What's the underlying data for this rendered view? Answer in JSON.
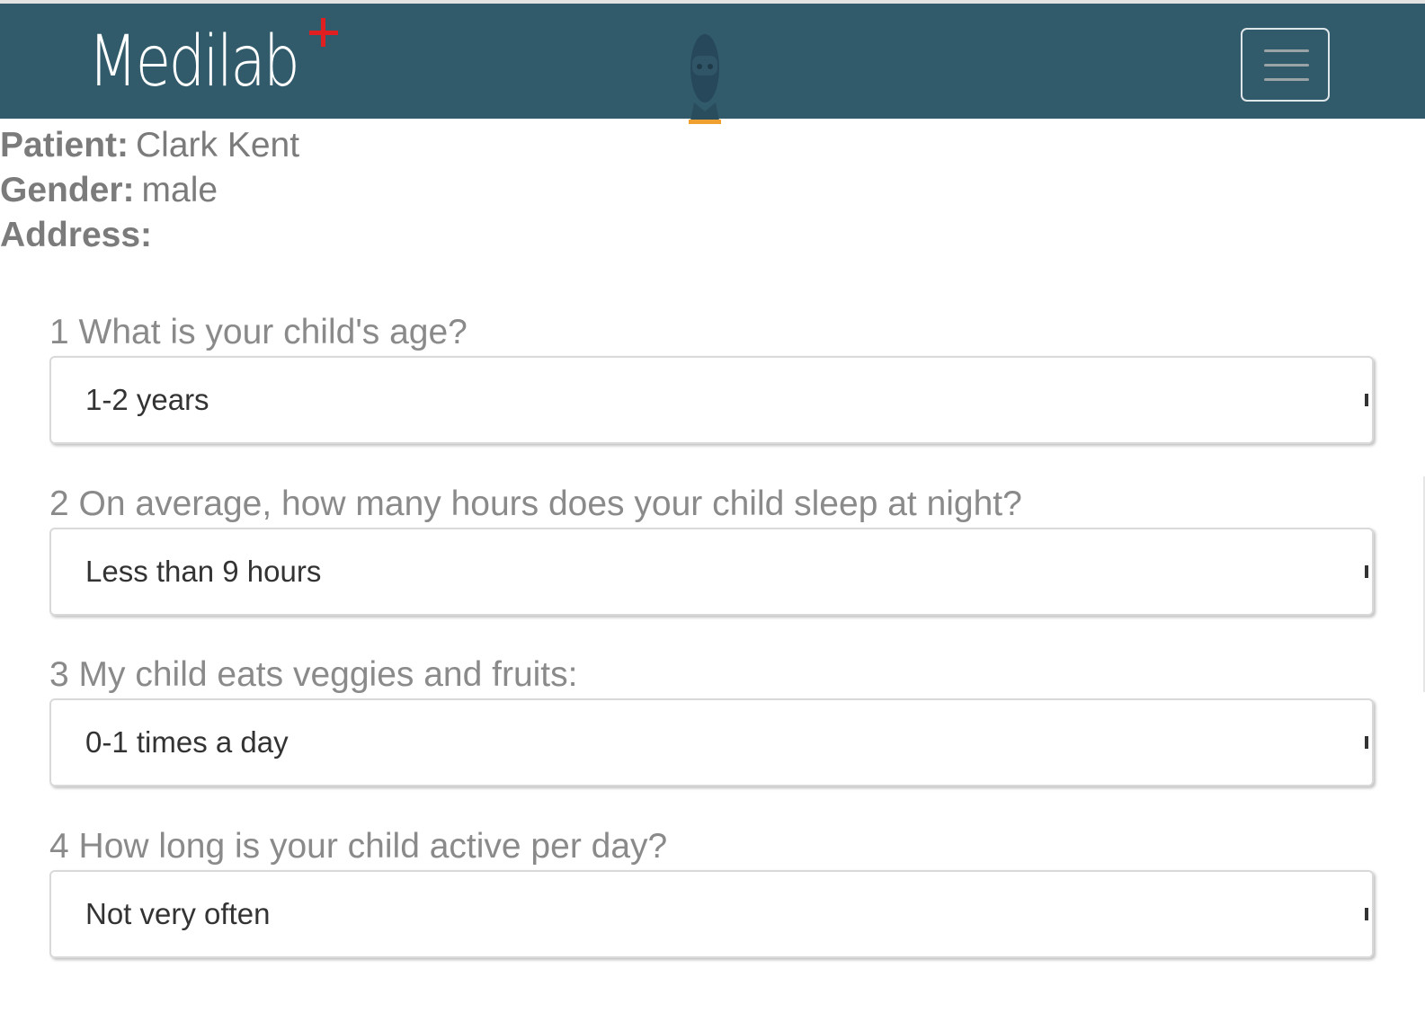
{
  "header": {
    "brand": "Medilab",
    "menu_button_label": "Toggle navigation",
    "menu_icon": "hamburger-icon",
    "avatar_icon": "user-avatar-icon",
    "plus_icon": "plus-icon",
    "colors": {
      "navbar": "#315b6b",
      "brand_plus": "#e02020",
      "avatar_accent": "#f0a030"
    }
  },
  "patient": {
    "name_label": "Patient:",
    "name": "Clark Kent",
    "gender_label": "Gender:",
    "gender": "male",
    "address_label": "Address:",
    "address": ""
  },
  "questions": [
    {
      "number": "1",
      "text": "What is your child's age?",
      "selected": "1-2 years"
    },
    {
      "number": "2",
      "text": "On average, how many hours does your child sleep at night?",
      "selected": "Less than 9 hours"
    },
    {
      "number": "3",
      "text": "My child eats veggies and fruits:",
      "selected": "0-1 times a day"
    },
    {
      "number": "4",
      "text": "How long is your child active per day?",
      "selected": "Not very often"
    }
  ]
}
